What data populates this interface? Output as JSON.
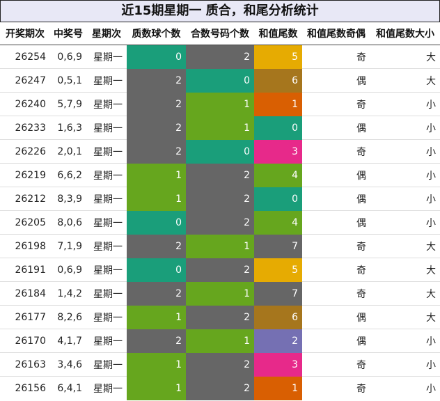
{
  "title": "近15期星期一 质合，和尾分析统计",
  "headers": [
    "开奖期次",
    "中奖号",
    "星期次",
    "质数球个数",
    "合数号码个数",
    "和值尾数",
    "和值尾数奇偶",
    "和值尾数大小"
  ],
  "colors": {
    "gray": "#666666",
    "teal": "#1a9e7a",
    "green": "#66a61e",
    "gold": "#e6ab02",
    "brown": "#a6761d",
    "orange": "#d95f02",
    "pink": "#e7298a",
    "purple": "#7570b3"
  },
  "rows": [
    {
      "issue": "26254",
      "nums": "0,6,9",
      "day": "星期一",
      "prime": "0",
      "prime_color": "teal",
      "comp": "2",
      "comp_color": "gray",
      "tail": "5",
      "tail_color": "gold",
      "parity": "奇",
      "size": "大"
    },
    {
      "issue": "26247",
      "nums": "0,5,1",
      "day": "星期一",
      "prime": "2",
      "prime_color": "gray",
      "comp": "0",
      "comp_color": "teal",
      "tail": "6",
      "tail_color": "brown",
      "parity": "偶",
      "size": "大"
    },
    {
      "issue": "26240",
      "nums": "5,7,9",
      "day": "星期一",
      "prime": "2",
      "prime_color": "gray",
      "comp": "1",
      "comp_color": "green",
      "tail": "1",
      "tail_color": "orange",
      "parity": "奇",
      "size": "小"
    },
    {
      "issue": "26233",
      "nums": "1,6,3",
      "day": "星期一",
      "prime": "2",
      "prime_color": "gray",
      "comp": "1",
      "comp_color": "green",
      "tail": "0",
      "tail_color": "teal",
      "parity": "偶",
      "size": "小"
    },
    {
      "issue": "26226",
      "nums": "2,0,1",
      "day": "星期一",
      "prime": "2",
      "prime_color": "gray",
      "comp": "0",
      "comp_color": "teal",
      "tail": "3",
      "tail_color": "pink",
      "parity": "奇",
      "size": "小"
    },
    {
      "issue": "26219",
      "nums": "6,6,2",
      "day": "星期一",
      "prime": "1",
      "prime_color": "green",
      "comp": "2",
      "comp_color": "gray",
      "tail": "4",
      "tail_color": "green",
      "parity": "偶",
      "size": "小"
    },
    {
      "issue": "26212",
      "nums": "8,3,9",
      "day": "星期一",
      "prime": "1",
      "prime_color": "green",
      "comp": "2",
      "comp_color": "gray",
      "tail": "0",
      "tail_color": "teal",
      "parity": "偶",
      "size": "小"
    },
    {
      "issue": "26205",
      "nums": "8,0,6",
      "day": "星期一",
      "prime": "0",
      "prime_color": "teal",
      "comp": "2",
      "comp_color": "gray",
      "tail": "4",
      "tail_color": "green",
      "parity": "偶",
      "size": "小"
    },
    {
      "issue": "26198",
      "nums": "7,1,9",
      "day": "星期一",
      "prime": "2",
      "prime_color": "gray",
      "comp": "1",
      "comp_color": "green",
      "tail": "7",
      "tail_color": "gray",
      "parity": "奇",
      "size": "大"
    },
    {
      "issue": "26191",
      "nums": "0,6,9",
      "day": "星期一",
      "prime": "0",
      "prime_color": "teal",
      "comp": "2",
      "comp_color": "gray",
      "tail": "5",
      "tail_color": "gold",
      "parity": "奇",
      "size": "大"
    },
    {
      "issue": "26184",
      "nums": "1,4,2",
      "day": "星期一",
      "prime": "2",
      "prime_color": "gray",
      "comp": "1",
      "comp_color": "green",
      "tail": "7",
      "tail_color": "gray",
      "parity": "奇",
      "size": "大"
    },
    {
      "issue": "26177",
      "nums": "8,2,6",
      "day": "星期一",
      "prime": "1",
      "prime_color": "green",
      "comp": "2",
      "comp_color": "gray",
      "tail": "6",
      "tail_color": "brown",
      "parity": "偶",
      "size": "大"
    },
    {
      "issue": "26170",
      "nums": "4,1,7",
      "day": "星期一",
      "prime": "2",
      "prime_color": "gray",
      "comp": "1",
      "comp_color": "green",
      "tail": "2",
      "tail_color": "purple",
      "parity": "偶",
      "size": "小"
    },
    {
      "issue": "26163",
      "nums": "3,4,6",
      "day": "星期一",
      "prime": "1",
      "prime_color": "green",
      "comp": "2",
      "comp_color": "gray",
      "tail": "3",
      "tail_color": "pink",
      "parity": "奇",
      "size": "小"
    },
    {
      "issue": "26156",
      "nums": "6,4,1",
      "day": "星期一",
      "prime": "1",
      "prime_color": "green",
      "comp": "2",
      "comp_color": "gray",
      "tail": "1",
      "tail_color": "orange",
      "parity": "奇",
      "size": "小"
    }
  ]
}
